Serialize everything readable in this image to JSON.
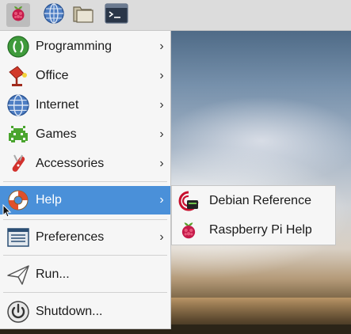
{
  "panel": {
    "buttons": [
      {
        "icon": "raspberry-icon",
        "active": true
      },
      {
        "icon": "globe-icon",
        "active": false
      },
      {
        "icon": "folder-icon",
        "active": false
      },
      {
        "icon": "terminal-icon",
        "active": false
      }
    ]
  },
  "menu": {
    "items": [
      {
        "label": "Programming",
        "icon": "programming-icon",
        "has_submenu": true
      },
      {
        "label": "Office",
        "icon": "office-icon",
        "has_submenu": true
      },
      {
        "label": "Internet",
        "icon": "globe-icon",
        "has_submenu": true
      },
      {
        "label": "Games",
        "icon": "games-icon",
        "has_submenu": true
      },
      {
        "label": "Accessories",
        "icon": "accessories-icon",
        "has_submenu": true
      },
      {
        "label": "Help",
        "icon": "lifebuoy-icon",
        "has_submenu": true,
        "highlighted": true
      },
      {
        "label": "Preferences",
        "icon": "preferences-icon",
        "has_submenu": true
      },
      {
        "label": "Run...",
        "icon": "run-icon",
        "has_submenu": false
      },
      {
        "label": "Shutdown...",
        "icon": "power-icon",
        "has_submenu": false
      }
    ],
    "arrow": "›"
  },
  "submenu": {
    "items": [
      {
        "label": "Debian Reference",
        "icon": "debian-icon"
      },
      {
        "label": "Raspberry Pi Help",
        "icon": "raspberry-icon"
      }
    ]
  },
  "colors": {
    "highlight": "#4a90d9",
    "menu_bg": "#f6f6f6",
    "panel_bg": "#dcdcdc"
  }
}
